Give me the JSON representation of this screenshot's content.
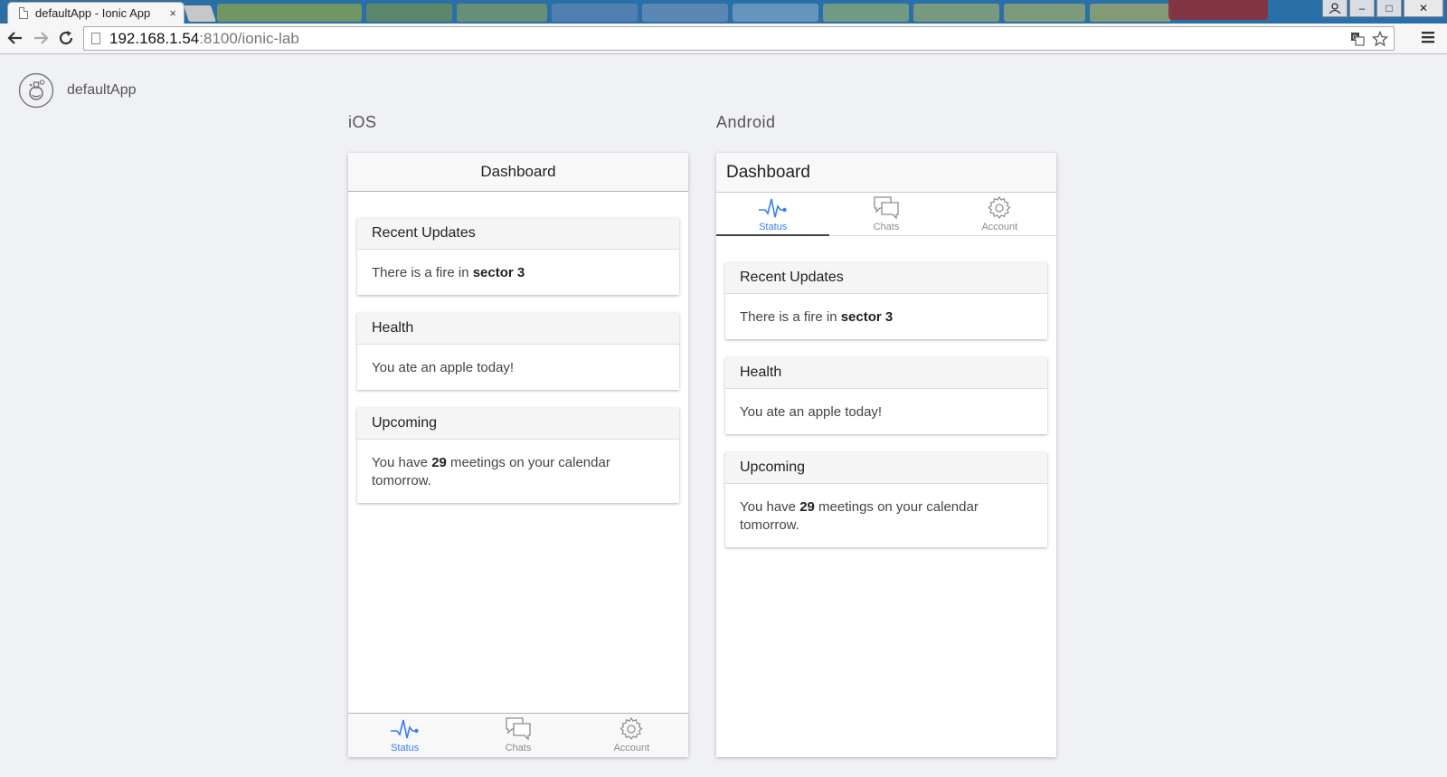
{
  "browser": {
    "tab_title": "defaultApp - Ionic App",
    "tab_close": "×",
    "url_host": "192.168.1.54",
    "url_rest": ":8100/ionic-lab",
    "window_controls": {
      "minimize": "–",
      "maximize": "□",
      "close": "✕"
    }
  },
  "app": {
    "name": "defaultApp"
  },
  "platforms": {
    "ios": {
      "label": "iOS",
      "header_title": "Dashboard"
    },
    "android": {
      "label": "Android",
      "header_title": "Dashboard"
    }
  },
  "tabs": [
    {
      "label": "Status",
      "icon": "pulse-icon",
      "active": true
    },
    {
      "label": "Chats",
      "icon": "chats-icon",
      "active": false
    },
    {
      "label": "Account",
      "icon": "gear-icon",
      "active": false
    }
  ],
  "cards": [
    {
      "title": "Recent Updates",
      "text_before": "There is a fire in ",
      "text_bold": "sector 3",
      "text_after": ""
    },
    {
      "title": "Health",
      "text_before": "You ate an apple today!",
      "text_bold": "",
      "text_after": ""
    },
    {
      "title": "Upcoming",
      "text_before": "You have ",
      "text_bold": "29",
      "text_after": " meetings on your calendar tomorrow."
    }
  ],
  "colors": {
    "accent": "#387ef5",
    "tabstrip": "#2a6fa8",
    "page_bg": "#f0f1f5"
  }
}
